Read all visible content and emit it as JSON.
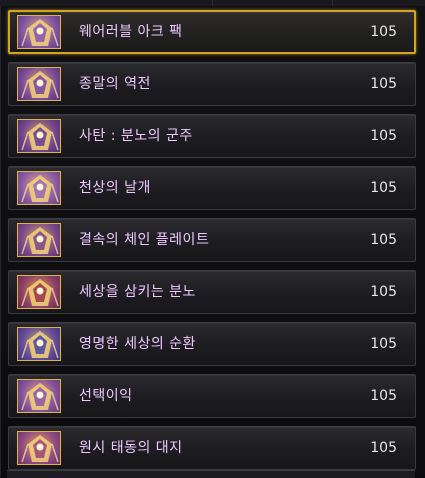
{
  "items": [
    {
      "name": "웨어러블 아크 팩",
      "level": "105",
      "selected": true,
      "icon": "armor-item-icon",
      "hue": "#8a5bb0"
    },
    {
      "name": "종말의 역전",
      "level": "105",
      "selected": false,
      "icon": "armor-item-icon",
      "hue": "#7c4aa0"
    },
    {
      "name": "사탄 : 분노의 군주",
      "level": "105",
      "selected": false,
      "icon": "armor-item-icon",
      "hue": "#6b3f8f"
    },
    {
      "name": "천상의 날개",
      "level": "105",
      "selected": false,
      "icon": "armor-item-icon",
      "hue": "#9a6ab6"
    },
    {
      "name": "결속의 체인 플레이트",
      "level": "105",
      "selected": false,
      "icon": "armor-item-icon",
      "hue": "#7f4a8a"
    },
    {
      "name": "세상을 삼키는 분노",
      "level": "105",
      "selected": false,
      "icon": "armor-item-icon",
      "hue": "#9b3b4a"
    },
    {
      "name": "영명한 세상의 순환",
      "level": "105",
      "selected": false,
      "icon": "armor-item-icon",
      "hue": "#4f4aa0"
    },
    {
      "name": "선택이익",
      "level": "105",
      "selected": false,
      "icon": "armor-item-icon",
      "hue": "#8f5aa8"
    },
    {
      "name": "원시 태동의 대지",
      "level": "105",
      "selected": false,
      "icon": "armor-item-icon",
      "hue": "#a04a7a"
    }
  ],
  "colors": {
    "name": "#f0c8ff",
    "level": "#e6e6e6",
    "selected_border": "#d4a51f"
  }
}
